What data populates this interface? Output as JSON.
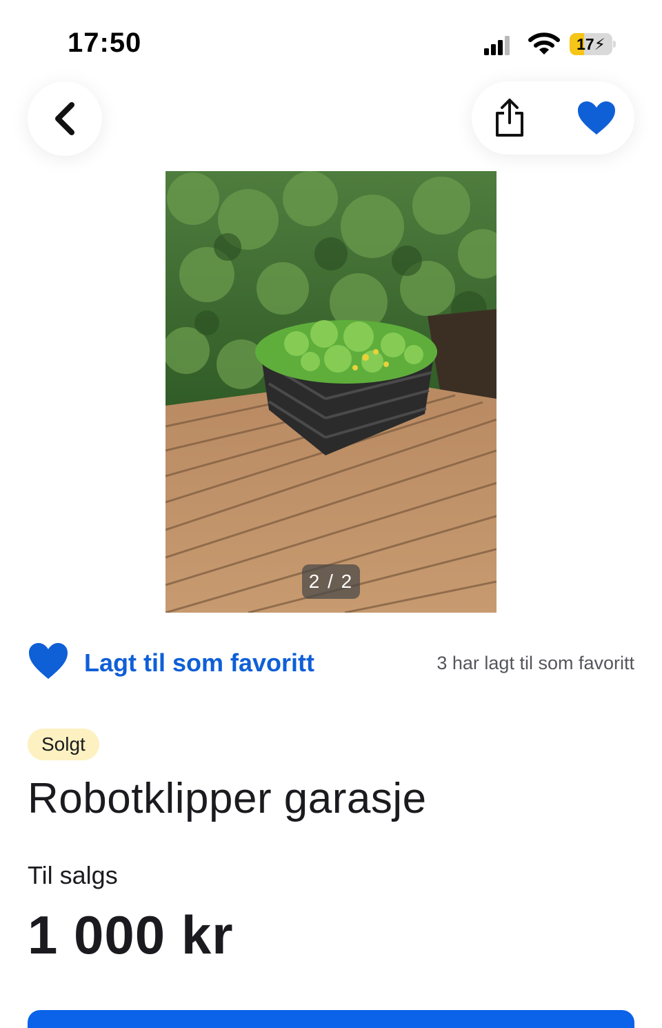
{
  "status_bar": {
    "time": "17:50",
    "battery_level": "17",
    "icons": [
      "signal-icon",
      "wifi-icon",
      "battery-charging-icon"
    ]
  },
  "toolbar": {
    "icons": [
      "chevron-left-icon",
      "share-icon",
      "heart-filled-icon"
    ]
  },
  "photo": {
    "counter": "2 / 2"
  },
  "favorite": {
    "label": "Lagt til som favoritt",
    "count_text": "3 har lagt til som favoritt"
  },
  "listing": {
    "status_badge": "Solgt",
    "title": "Robotklipper garasje",
    "category": "Til salgs",
    "price": "1 000 kr"
  },
  "colors": {
    "accent_blue": "#0f5fd7",
    "badge_bg": "#fdf1c2",
    "battery_fill": "#f5c518"
  }
}
